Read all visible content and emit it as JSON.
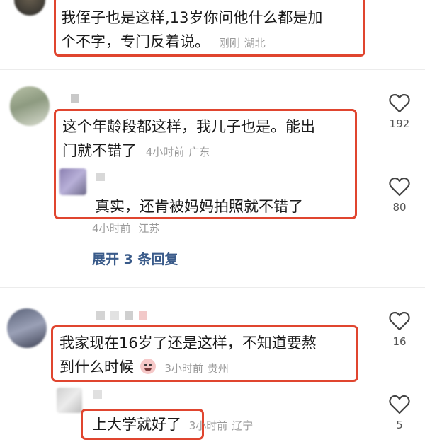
{
  "comments": [
    {
      "text": "我侄子也是这样,13岁你问他什么都是加个不字，专门反着说。",
      "line1": "我侄子也是这样,13岁你问他什么都是加",
      "line2": "个不字，专门反着说。",
      "time": "刚刚",
      "location": "湖北"
    },
    {
      "line1": "这个年龄段都这样，我儿子也是。能出",
      "line2": "门就不错了",
      "time": "4小时前",
      "location": "广东",
      "likes": "192",
      "reply": {
        "text": "真实，还肯被妈妈拍照就不错了",
        "time": "4小时前",
        "location": "江苏",
        "likes": "80"
      },
      "expand_label": "展开 3 条回复"
    },
    {
      "line1": "我家现在16岁了还是这样，不知道要熬",
      "line2": "到什么时候",
      "emoji": "crying-emoji",
      "time": "3小时前",
      "location": "贵州",
      "likes": "16",
      "reply": {
        "text": "上大学就好了",
        "time": "3小时前",
        "location": "辽宁",
        "likes": "5"
      }
    }
  ],
  "colors": {
    "highlight": "#e0452f",
    "meta": "#9a9a9a",
    "expand": "#3a5b8a"
  }
}
